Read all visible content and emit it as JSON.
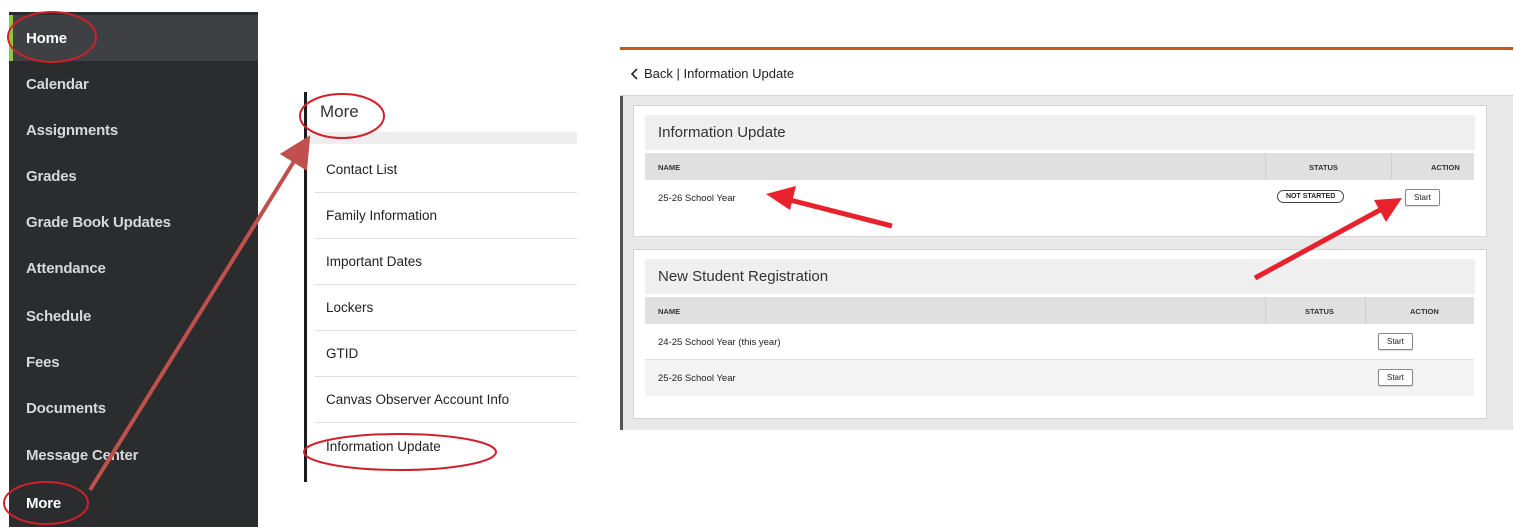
{
  "sidebar": {
    "items": [
      {
        "label": "Home"
      },
      {
        "label": "Calendar"
      },
      {
        "label": "Assignments"
      },
      {
        "label": "Grades"
      },
      {
        "label": "Grade Book Updates"
      },
      {
        "label": "Attendance"
      },
      {
        "label": "Schedule"
      },
      {
        "label": "Fees"
      },
      {
        "label": "Documents"
      },
      {
        "label": "Message Center"
      },
      {
        "label": "More"
      }
    ],
    "accent_color": "#8cc63f"
  },
  "more_menu": {
    "title": "More",
    "items": [
      {
        "label": "Contact List"
      },
      {
        "label": "Family Information"
      },
      {
        "label": "Important Dates"
      },
      {
        "label": "Lockers"
      },
      {
        "label": "GTID"
      },
      {
        "label": "Canvas Observer Account Info"
      },
      {
        "label": "Information Update"
      }
    ]
  },
  "info_update": {
    "back_label": "Back | Information Update",
    "sections": [
      {
        "title": "Information Update",
        "columns": [
          "NAME",
          "STATUS",
          "ACTION"
        ],
        "rows": [
          {
            "name": "25-26 School Year",
            "status": "NOT STARTED",
            "action": "Start"
          }
        ]
      },
      {
        "title": "New Student Registration",
        "columns": [
          "NAME",
          "STATUS",
          "ACTION"
        ],
        "rows": [
          {
            "name": "24-25 School Year (this year)",
            "action": "Start"
          },
          {
            "name": "25-26 School Year",
            "action": "Start"
          }
        ]
      }
    ],
    "header_accent": "#c55a11"
  },
  "annotation_color": "#e8212c"
}
